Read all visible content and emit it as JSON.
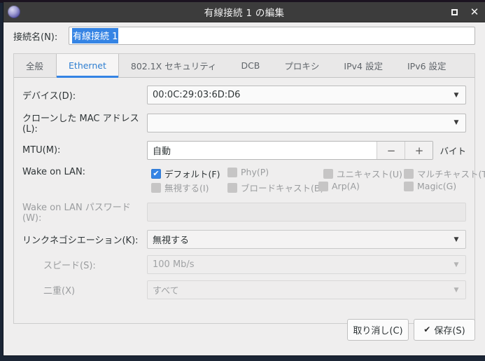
{
  "window": {
    "title": "有線接続 1 の編集",
    "app_icon": "globe-icon",
    "controls": {
      "maximize": "maximize-icon",
      "close": "close-icon"
    }
  },
  "connection_name": {
    "label": "接続名(N):",
    "value": "有線接続 1",
    "selected": true,
    "selection_color": "#3584e4"
  },
  "tabs": [
    {
      "label": "全般",
      "active": false
    },
    {
      "label": "Ethernet",
      "active": true
    },
    {
      "label": "802.1X セキュリティ",
      "active": false
    },
    {
      "label": "DCB",
      "active": false
    },
    {
      "label": "プロキシ",
      "active": false
    },
    {
      "label": "IPv4 設定",
      "active": false
    },
    {
      "label": "IPv6 設定",
      "active": false
    }
  ],
  "form": {
    "device": {
      "label": "デバイス(D):",
      "value": "00:0C:29:03:6D:D6",
      "arrow": "▼"
    },
    "cloned_mac": {
      "label": "クローンした MAC アドレス(L):",
      "value": "",
      "arrow": "▼"
    },
    "mtu": {
      "label": "MTU(M):",
      "value": "自動",
      "minus": "−",
      "plus": "+",
      "unit": "バイト"
    },
    "wake_on_lan": {
      "label": "Wake on LAN:",
      "options": [
        {
          "label": "デフォルト(F)",
          "checked": true,
          "enabled": true,
          "col": 0,
          "row": 0
        },
        {
          "label": "Phy(P)",
          "checked": false,
          "enabled": false,
          "col": 1,
          "row": 0
        },
        {
          "label": "ユニキャスト(U)",
          "checked": false,
          "enabled": false,
          "col": 2,
          "row": 0
        },
        {
          "label": "マルチキャスト(T)",
          "checked": false,
          "enabled": false,
          "col": 3,
          "row": 0
        },
        {
          "label": "無視する(I)",
          "checked": false,
          "enabled": false,
          "col": 0,
          "row": 1
        },
        {
          "label": "ブロードキャスト(B)",
          "checked": false,
          "enabled": false,
          "col": 1,
          "row": 1
        },
        {
          "label": "Arp(A)",
          "checked": false,
          "enabled": false,
          "col": 2,
          "row": 1
        },
        {
          "label": "Magic(G)",
          "checked": false,
          "enabled": false,
          "col": 3,
          "row": 1
        }
      ]
    },
    "wol_password": {
      "label": "Wake on LAN パスワード(W):",
      "value": "",
      "enabled": false
    },
    "link_negotiation": {
      "label": "リンクネゴシエーション(K):",
      "value": "無視する",
      "arrow": "▼",
      "enabled": true
    },
    "speed": {
      "label": "スピード(S):",
      "value": "100 Mb/s",
      "arrow": "▼",
      "enabled": false
    },
    "duplex": {
      "label": "二重(X)",
      "value": "すべて",
      "arrow": "▼",
      "enabled": false
    }
  },
  "actions": {
    "cancel": "取り消し(C)",
    "save": "保存(S)",
    "save_icon": "✔"
  }
}
